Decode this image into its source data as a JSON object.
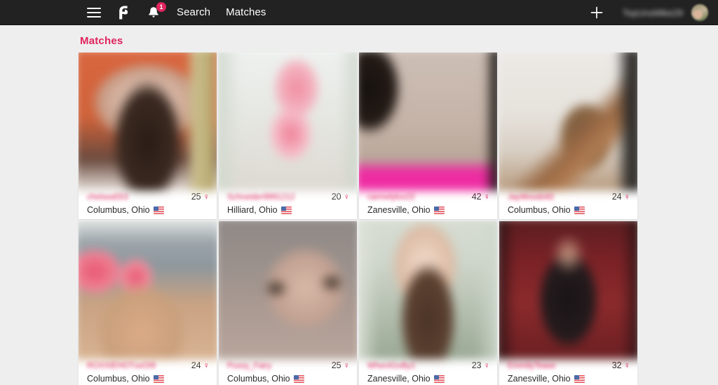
{
  "nav": {
    "menu_icon": "hamburger-menu-icon",
    "logo_icon": "brand-logo-icon",
    "bell_icon": "notification-bell-icon",
    "notification_count": "1",
    "links": [
      {
        "label": "Search",
        "name": "nav-link-search"
      },
      {
        "label": "Matches",
        "name": "nav-link-matches"
      }
    ],
    "plus_icon": "add-plus-icon",
    "username": "TopUnsMike29",
    "avatar_icon": "user-avatar"
  },
  "page": {
    "title": "Matches",
    "accent_color": "#e0245e",
    "background_color": "#eeeeee"
  },
  "cards": [
    {
      "name": "chelsea553",
      "age": "25",
      "gender_symbol": "♀",
      "location": "Columbus, Ohio",
      "flag": "us-flag-icon",
      "photo": "profile-photo-1"
    },
    {
      "name": "Schneider9991212",
      "age": "20",
      "gender_symbol": "♀",
      "location": "Hilliard, Ohio",
      "flag": "us-flag-icon",
      "photo": "profile-photo-2"
    },
    {
      "name": "carmelyluv22",
      "age": "42",
      "gender_symbol": "♀",
      "location": "Zanesville, Ohio",
      "flag": "us-flag-icon",
      "photo": "profile-photo-3"
    },
    {
      "name": "JayWoods92",
      "age": "24",
      "gender_symbol": "♀",
      "location": "Columbus, Ohio",
      "flag": "us-flag-icon",
      "photo": "profile-photo-4"
    },
    {
      "name": "ROXXIEHOTxxOI9",
      "age": "24",
      "gender_symbol": "♀",
      "location": "Columbus, Ohio",
      "flag": "us-flag-icon",
      "photo": "profile-photo-5"
    },
    {
      "name": "Pussy_Fairy",
      "age": "25",
      "gender_symbol": "♀",
      "location": "Columbus, Ohio",
      "flag": "us-flag-icon",
      "photo": "profile-photo-6"
    },
    {
      "name": "WhenIGoBy1",
      "age": "23",
      "gender_symbol": "♀",
      "location": "Zanesville, Ohio",
      "flag": "us-flag-icon",
      "photo": "profile-photo-7"
    },
    {
      "name": "EmmilyTease",
      "age": "32",
      "gender_symbol": "♀",
      "location": "Zanesville, Ohio",
      "flag": "us-flag-icon",
      "photo": "profile-photo-8"
    }
  ]
}
